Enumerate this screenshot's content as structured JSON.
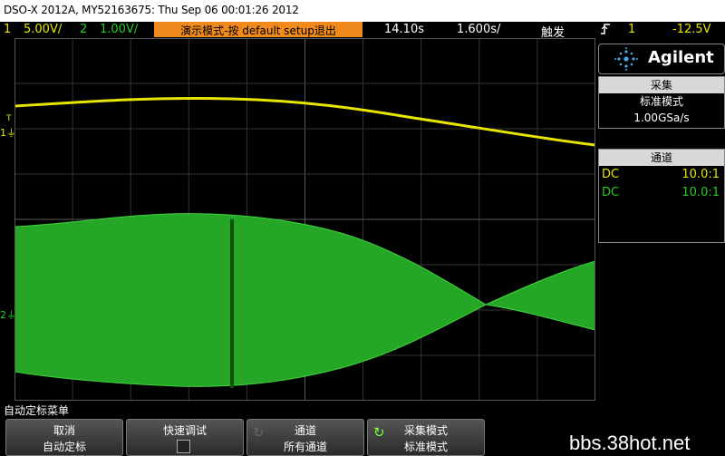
{
  "window": {
    "title": "DSO-X 2012A, MY52163675: Thu Sep 06 00:01:26 2012"
  },
  "status": {
    "ch1_num": "1",
    "ch1_scale": "5.00V/",
    "ch2_num": "2",
    "ch2_scale": "1.00V/",
    "demo_msg": "演示模式-按 default setup退出",
    "time_pos": "14.10s",
    "time_base": "1.600s/",
    "trig_mode": "触发",
    "trig_slope_icon": "rising-edge-icon",
    "trig_src": "1",
    "trig_level": "-12.5V"
  },
  "colors": {
    "ch1": "#e6e600",
    "ch2": "#22cc22",
    "demo": "#f08a1c",
    "grid": "#3a3a3a"
  },
  "markers": {
    "trigger": "T",
    "ch1": "1",
    "ch2": "2"
  },
  "right_panel": {
    "logo_name": "Agilent",
    "acq_header": "采集",
    "acq_mode": "标准模式",
    "acq_rate": "1.00GSa/s",
    "chan_header": "通道",
    "ch1_coupling": "DC",
    "ch1_probe": "10.0:1",
    "ch2_coupling": "DC",
    "ch2_probe": "10.0:1"
  },
  "menu": {
    "title": "自动定标菜单",
    "softkeys": [
      {
        "line1": "取消",
        "line2": "自动定标"
      },
      {
        "line1": "快速调试",
        "line2": ""
      },
      {
        "line1": "通道",
        "line2": "所有通道"
      },
      {
        "line1": "采集模式",
        "line2": "标准模式"
      }
    ]
  },
  "watermark": "bbs.38hot.net"
}
